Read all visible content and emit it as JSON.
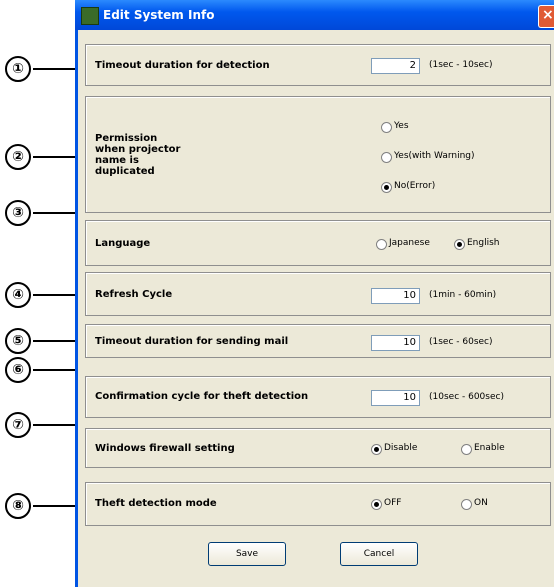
{
  "window": {
    "title": "Edit System Info",
    "close_glyph": "×"
  },
  "callouts": [
    "①",
    "②",
    "③",
    "④",
    "⑤",
    "⑥",
    "⑦",
    "⑧"
  ],
  "timeout_detection": {
    "label": "Timeout duration for detection",
    "value": "2",
    "range": "(1sec - 10sec)"
  },
  "permission": {
    "label_lines": [
      "Permission",
      "when projector",
      "name is",
      "duplicated"
    ],
    "options": [
      "Yes",
      "Yes(with Warning)",
      "No(Error)"
    ],
    "selected": "No(Error)"
  },
  "language": {
    "label": "Language",
    "options": [
      "Japanese",
      "English"
    ],
    "selected": "English"
  },
  "refresh": {
    "label": "Refresh Cycle",
    "value": "10",
    "range": "(1min - 60min)"
  },
  "timeout_mail": {
    "label": "Timeout duration for sending mail",
    "value": "10",
    "range": "(1sec - 60sec)"
  },
  "theft_cycle": {
    "label": "Confirmation cycle for theft detection",
    "value": "10",
    "range": "(10sec - 600sec)"
  },
  "firewall": {
    "label": "Windows firewall setting",
    "options": [
      "Disable",
      "Enable"
    ],
    "selected": "Disable"
  },
  "theft_mode": {
    "label": "Theft detection mode",
    "options": [
      "OFF",
      "ON"
    ],
    "selected": "OFF"
  },
  "buttons": {
    "save": "Save",
    "cancel": "Cancel"
  },
  "icons": {
    "app": "app-icon",
    "close": "close-icon"
  }
}
